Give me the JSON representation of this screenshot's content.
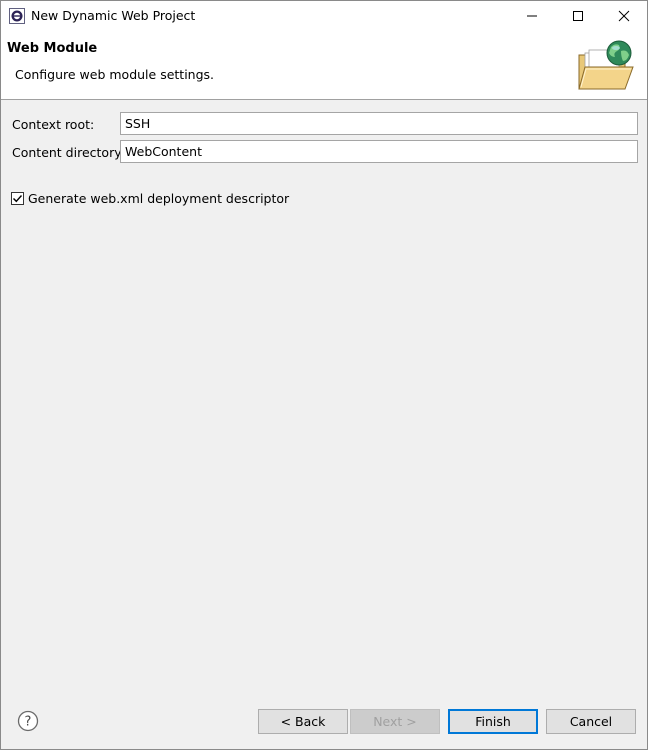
{
  "window": {
    "title": "New Dynamic Web Project",
    "icon": "eclipse-app-icon"
  },
  "banner": {
    "title": "Web Module",
    "description": "Configure web module settings.",
    "graphic": "folder-globe-icon"
  },
  "form": {
    "context_root_label": "Context root:",
    "context_root_value": "SSH",
    "content_directory_label": "Content directory:",
    "content_directory_value": "WebContent",
    "generate_descriptor_label": "Generate web.xml deployment descriptor",
    "generate_descriptor_checked": true
  },
  "buttons": {
    "back": "< Back",
    "next": "Next >",
    "finish": "Finish",
    "cancel": "Cancel",
    "next_enabled": false,
    "help_icon": "help-icon"
  },
  "colors": {
    "accent": "#0078d7",
    "dialog_bg": "#f0f0f0",
    "banner_bg": "#ffffff"
  }
}
